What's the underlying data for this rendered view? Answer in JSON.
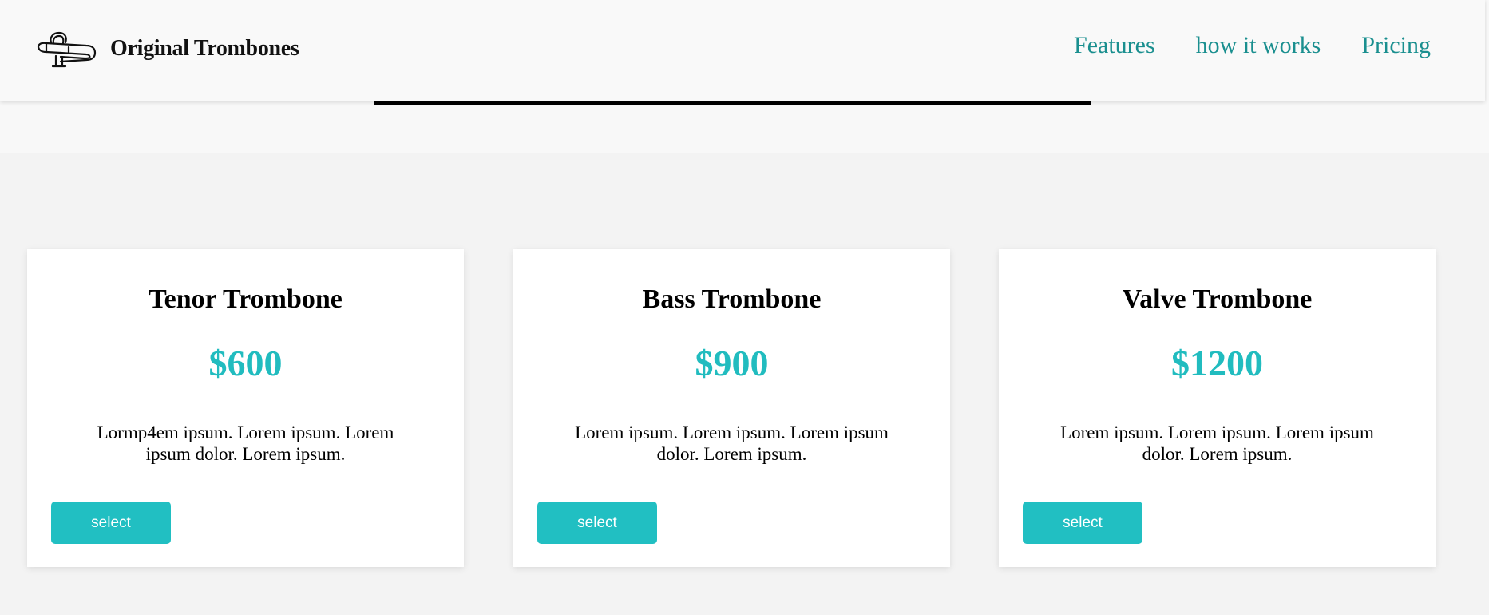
{
  "header": {
    "brand_name": "Original Trombones",
    "logo_icon": "trombone-icon"
  },
  "nav": {
    "items": [
      {
        "label": "Features"
      },
      {
        "label": "how it works"
      },
      {
        "label": "Pricing"
      }
    ],
    "link_color": "#1a8f8f"
  },
  "pricing": {
    "accent_color": "#21bcbf",
    "cards": [
      {
        "title": "Tenor Trombone",
        "price": "$600",
        "description": "Lormp4em ipsum. Lorem ipsum. Lorem ipsum dolor. Lorem ipsum.",
        "button_label": "select"
      },
      {
        "title": "Bass Trombone",
        "price": "$900",
        "description": "Lorem ipsum. Lorem ipsum. Lorem ipsum dolor. Lorem ipsum.",
        "button_label": "select"
      },
      {
        "title": "Valve Trombone",
        "price": "$1200",
        "description": "Lorem ipsum. Lorem ipsum. Lorem ipsum dolor. Lorem ipsum.",
        "button_label": "select"
      }
    ]
  }
}
